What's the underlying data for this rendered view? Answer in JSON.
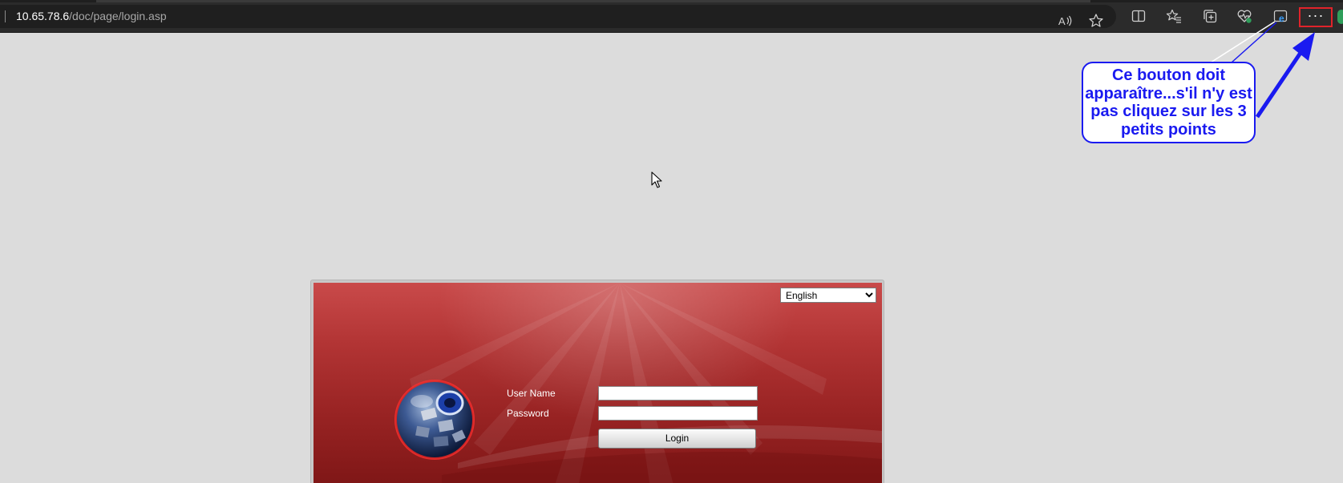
{
  "browser": {
    "url_host": "10.65.78.6",
    "url_path": "/doc/page/login.asp",
    "icons": [
      "read-aloud-icon",
      "favorite-star-icon",
      "split-screen-icon",
      "favorites-icon",
      "collections-icon",
      "browser-essentials-icon",
      "ie-mode-icon",
      "more-options-icon"
    ],
    "more_label": "···"
  },
  "annotation": {
    "text": "Ce bouton doit apparaître...s'il n'y est pas cliquez sur les 3 petits points",
    "color": "#1a1af0",
    "highlight_color": "#e0232a"
  },
  "login": {
    "language_selected": "English",
    "username_label": "User Name",
    "password_label": "Password",
    "username_value": "",
    "password_value": "",
    "login_button": "Login",
    "panel_color": "#b23434"
  }
}
